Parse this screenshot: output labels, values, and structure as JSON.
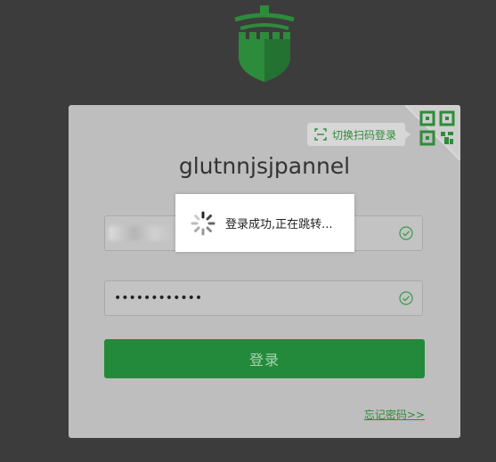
{
  "app": {
    "name": "glutnnjsjpannel"
  },
  "qr_switch": {
    "label": "切换扫码登录",
    "icon": "qr-code-icon"
  },
  "form": {
    "username_value": "",
    "password_value": "••••••••••••",
    "submit_label": "登录",
    "forgot_label": "忘记密码>>"
  },
  "toast": {
    "message": "登录成功,正在跳转..."
  },
  "colors": {
    "background": "#3c3c3c",
    "card": "#bebebe",
    "brand_green": "#248a3b",
    "logo_green": "#2d8b3c"
  }
}
